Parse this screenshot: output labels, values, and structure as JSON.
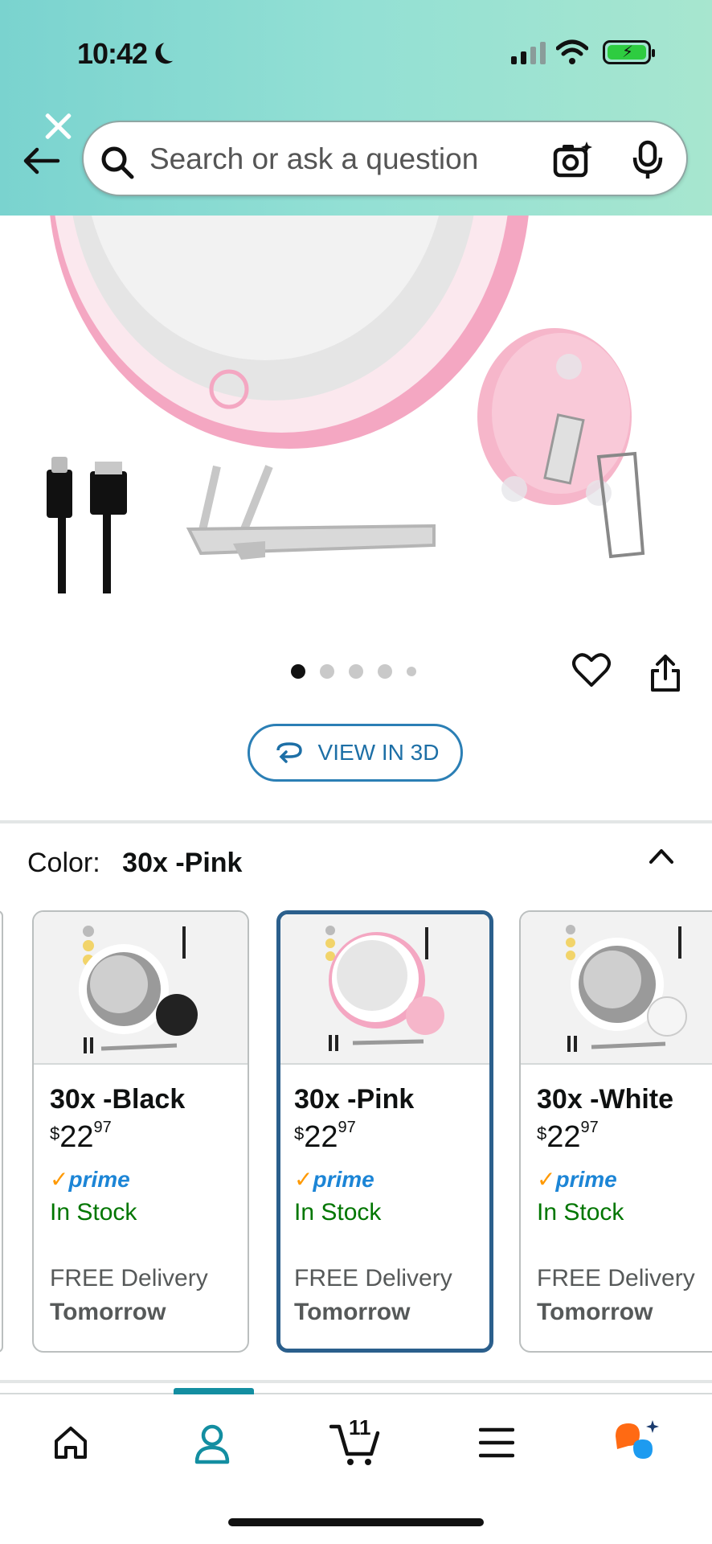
{
  "status_bar": {
    "time": "10:42"
  },
  "header": {
    "search": {
      "placeholder": "Search or ask a question"
    }
  },
  "gallery": {
    "view3d_label": "VIEW IN 3D",
    "dot_count": 5,
    "active_dot": 0
  },
  "colors": {
    "label": "Color:",
    "selected": "30x -Pink",
    "options": [
      {
        "name": "30x -Black",
        "price_currency": "$",
        "price_whole": "22",
        "price_fraction": "97",
        "prime": "prime",
        "stock": "In Stock",
        "delivery": "FREE Delivery",
        "when": "Tomorrow"
      },
      {
        "name": "30x -Pink",
        "price_currency": "$",
        "price_whole": "22",
        "price_fraction": "97",
        "prime": "prime",
        "stock": "In Stock",
        "delivery": "FREE Delivery",
        "when": "Tomorrow"
      },
      {
        "name": "30x -White",
        "price_currency": "$",
        "price_whole": "22",
        "price_fraction": "97",
        "prime": "prime",
        "stock": "In Stock",
        "delivery": "FREE Delivery",
        "when": "Tomorrow"
      }
    ]
  },
  "bottom_nav": {
    "cart_count": "11",
    "active": "account"
  },
  "theme": {
    "accent": "#138ea1",
    "selected_border": "#2b5f8c",
    "prime_blue": "#1c85d6",
    "stock_green": "#007600"
  }
}
